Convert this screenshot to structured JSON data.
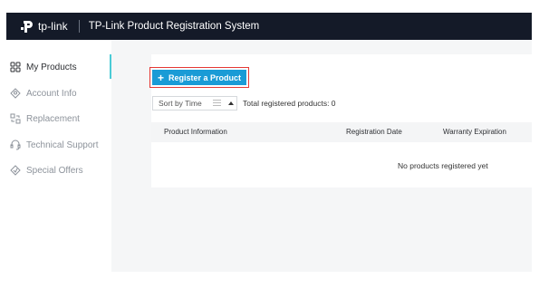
{
  "header": {
    "logo_text": "tp-link",
    "app_title": "TP-Link Product Registration System"
  },
  "sidebar": {
    "items": [
      {
        "label": "My Products",
        "icon": "grid-icon",
        "active": true
      },
      {
        "label": "Account Info",
        "icon": "account-icon",
        "active": false
      },
      {
        "label": "Replacement",
        "icon": "replacement-icon",
        "active": false
      },
      {
        "label": "Technical Support",
        "icon": "headset-icon",
        "active": false
      },
      {
        "label": "Special Offers",
        "icon": "tag-icon",
        "active": false
      }
    ]
  },
  "main": {
    "register_button_label": "Register a Product",
    "sort_label": "Sort by Time",
    "total_text": "Total registered products: 0",
    "table": {
      "columns": [
        "Product Information",
        "Registration Date",
        "Warranty Expiration"
      ],
      "empty_text": "No products registered yet"
    }
  },
  "colors": {
    "header_bg": "#141a28",
    "accent": "#4acbd6",
    "button": "#1a9bd6",
    "highlight": "#e53935"
  }
}
